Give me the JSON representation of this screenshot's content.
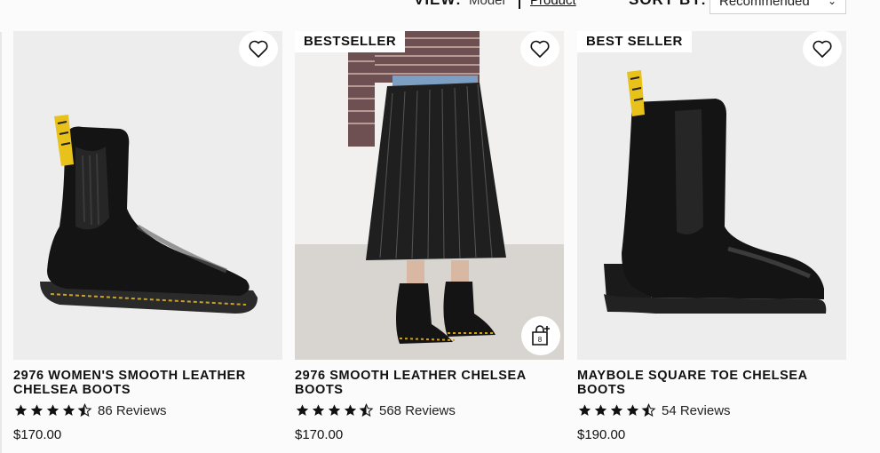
{
  "toolbar": {
    "view_label": "VIEW:",
    "toggle_model": "Model",
    "toggle_product": "Product",
    "sort_label": "SORT BY:",
    "sort_value": "Recommended"
  },
  "products": [
    {
      "badge": "",
      "title": "2976 Women's Smooth Leather Chelsea Boots",
      "rating": 4.5,
      "reviews": "86 Reviews",
      "price": "$170.00"
    },
    {
      "badge": "BESTSELLER",
      "title": "2976 Smooth Leather Chelsea Boots",
      "rating": 4.5,
      "reviews": "568 Reviews",
      "price": "$170.00",
      "quick_add_badge": "8"
    },
    {
      "badge": "BEST SELLER",
      "title": "Maybole Square Toe Chelsea Boots",
      "rating": 4.5,
      "reviews": "54 Reviews",
      "price": "$190.00"
    }
  ],
  "colors": {
    "accent": "#111111",
    "lace_yellow": "#e8c21a",
    "stitch": "#c9a227"
  },
  "icons": [
    "heart-icon",
    "star-icon",
    "shopping-bag-icon",
    "chevron-down-icon"
  ]
}
